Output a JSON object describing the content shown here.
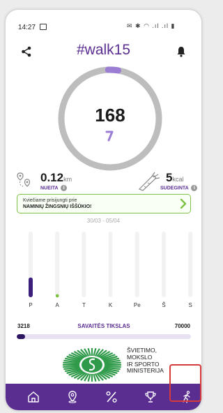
{
  "status_bar": {
    "time": "14:27",
    "icons": "✉ ✱ ◠ .ıl .ıl ▮"
  },
  "header": {
    "title": "#walk15",
    "share_icon": "share-icon",
    "bell_icon": "bell-icon"
  },
  "steps": {
    "value": "168",
    "progress": 0.02
  },
  "distance": {
    "value": "0.12",
    "unit": "km",
    "label": "NUEITA"
  },
  "calories": {
    "value": "5",
    "unit": "kcal",
    "label": "SUDEGINTA"
  },
  "challenge": {
    "line1": "Kviečiame prisijungti prie",
    "line2": "NAMINIŲ ŽINGSNIŲ IŠŠŪKIO!"
  },
  "week": {
    "range": "30/03 - 05/04"
  },
  "chart_data": {
    "type": "bar",
    "categories": [
      "P",
      "A",
      "T",
      "K",
      "Pe",
      "Š",
      "S"
    ],
    "values": [
      0.3,
      0.01,
      0,
      0,
      0,
      0,
      0
    ],
    "ylim": [
      0,
      1
    ],
    "grid": false
  },
  "goal": {
    "start": "3218",
    "label": "SAVAITĖS TIKSLAS",
    "end": "70000",
    "progress": 0.046
  },
  "ministry": {
    "lines": [
      "ŠVIETIMO,",
      "MOKSLO",
      "IR SPORTO",
      "MINISTERIJA"
    ]
  },
  "nav": [
    "home-icon",
    "map-pin-icon",
    "percent-icon",
    "trophy-icon",
    "walker-icon"
  ],
  "colors": {
    "brand": "#5a2d91",
    "accent": "#7dc242",
    "ring": "#bdbdbd",
    "nav_bg": "#5a2d91",
    "highlight": "#d63a3a"
  }
}
